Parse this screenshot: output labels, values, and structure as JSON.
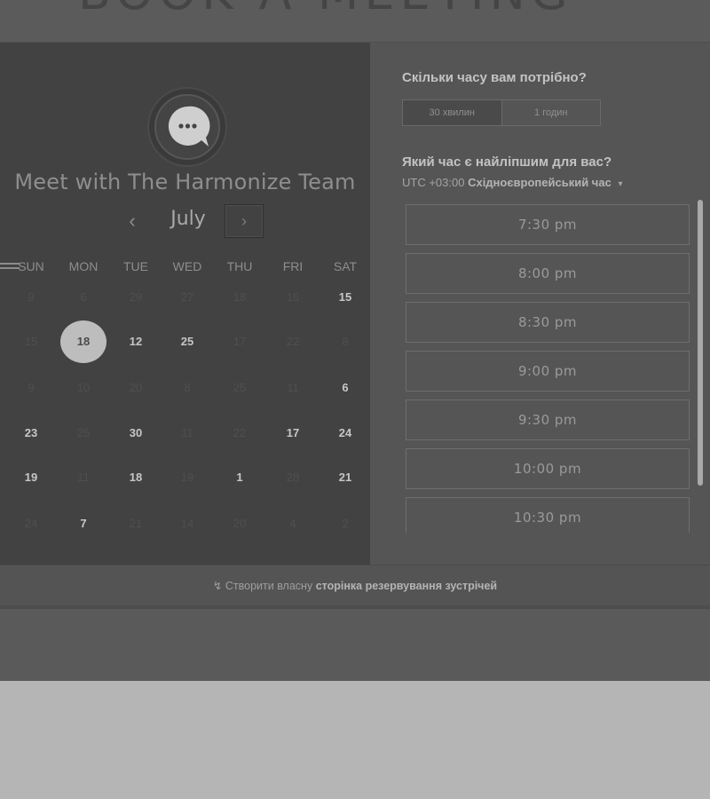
{
  "header": {
    "partial_text": "BOOK A MEETING"
  },
  "calendar": {
    "title": "Meet with The Harmonize Team",
    "month": "July",
    "prev_icon": "‹",
    "next_icon": "›",
    "weekdays": [
      "SUN",
      "MON",
      "TUE",
      "WED",
      "THU",
      "FRI",
      "SAT"
    ],
    "weeks": [
      [
        {
          "d": "9",
          "s": "dim"
        },
        {
          "d": "6",
          "s": "dim"
        },
        {
          "d": "29",
          "s": "dim"
        },
        {
          "d": "27",
          "s": "dim"
        },
        {
          "d": "18",
          "s": "dim"
        },
        {
          "d": "16",
          "s": "dim"
        },
        {
          "d": "15",
          "s": "bright"
        }
      ],
      [
        {
          "d": "15",
          "s": "dim"
        },
        {
          "d": "18",
          "s": "selected"
        },
        {
          "d": "12",
          "s": "bright"
        },
        {
          "d": "25",
          "s": "bright"
        },
        {
          "d": "17",
          "s": "dim"
        },
        {
          "d": "22",
          "s": "dim"
        },
        {
          "d": "8",
          "s": "dim"
        }
      ],
      [
        {
          "d": "9",
          "s": "dim"
        },
        {
          "d": "10",
          "s": "dim"
        },
        {
          "d": "20",
          "s": "dim"
        },
        {
          "d": "8",
          "s": "dim"
        },
        {
          "d": "25",
          "s": "dim"
        },
        {
          "d": "11",
          "s": "dim"
        },
        {
          "d": "6",
          "s": "bright"
        }
      ],
      [
        {
          "d": "23",
          "s": "bright"
        },
        {
          "d": "25",
          "s": "dim"
        },
        {
          "d": "30",
          "s": "bright"
        },
        {
          "d": "11",
          "s": "dim"
        },
        {
          "d": "22",
          "s": "dim"
        },
        {
          "d": "17",
          "s": "bright"
        },
        {
          "d": "24",
          "s": "bright"
        }
      ],
      [
        {
          "d": "19",
          "s": "bright"
        },
        {
          "d": "11",
          "s": "dim"
        },
        {
          "d": "18",
          "s": "bright"
        },
        {
          "d": "19",
          "s": "dim"
        },
        {
          "d": "1",
          "s": "bright"
        },
        {
          "d": "28",
          "s": "dim"
        },
        {
          "d": "21",
          "s": "bright"
        }
      ],
      [
        {
          "d": "24",
          "s": "dim"
        },
        {
          "d": "7",
          "s": "bright"
        },
        {
          "d": "21",
          "s": "dim"
        },
        {
          "d": "14",
          "s": "dim"
        },
        {
          "d": "20",
          "s": "dim"
        },
        {
          "d": "4",
          "s": "dim"
        },
        {
          "d": "2",
          "s": "dim"
        }
      ]
    ]
  },
  "booking": {
    "duration_question": "Скільки часу вам потрібно?",
    "durations": [
      "30 хвилин",
      "1 годин"
    ],
    "time_question": "Який час є найліпшим для вас?",
    "timezone_offset": "UTC +03:00",
    "timezone_name": "Східноєвропейський час",
    "timezone_caret": "▾",
    "slots": [
      "7:30 pm",
      "8:00 pm",
      "8:30 pm",
      "9:00 pm",
      "9:30 pm",
      "10:00 pm",
      "10:30 pm"
    ]
  },
  "footer": {
    "icon": "↯",
    "text_plain": "Створити власну",
    "text_bold": "сторінка резервування зустрічей"
  },
  "colors": {
    "selected_day": "#bdbdbd",
    "panel_left": "#424242",
    "panel_right": "#555555"
  }
}
